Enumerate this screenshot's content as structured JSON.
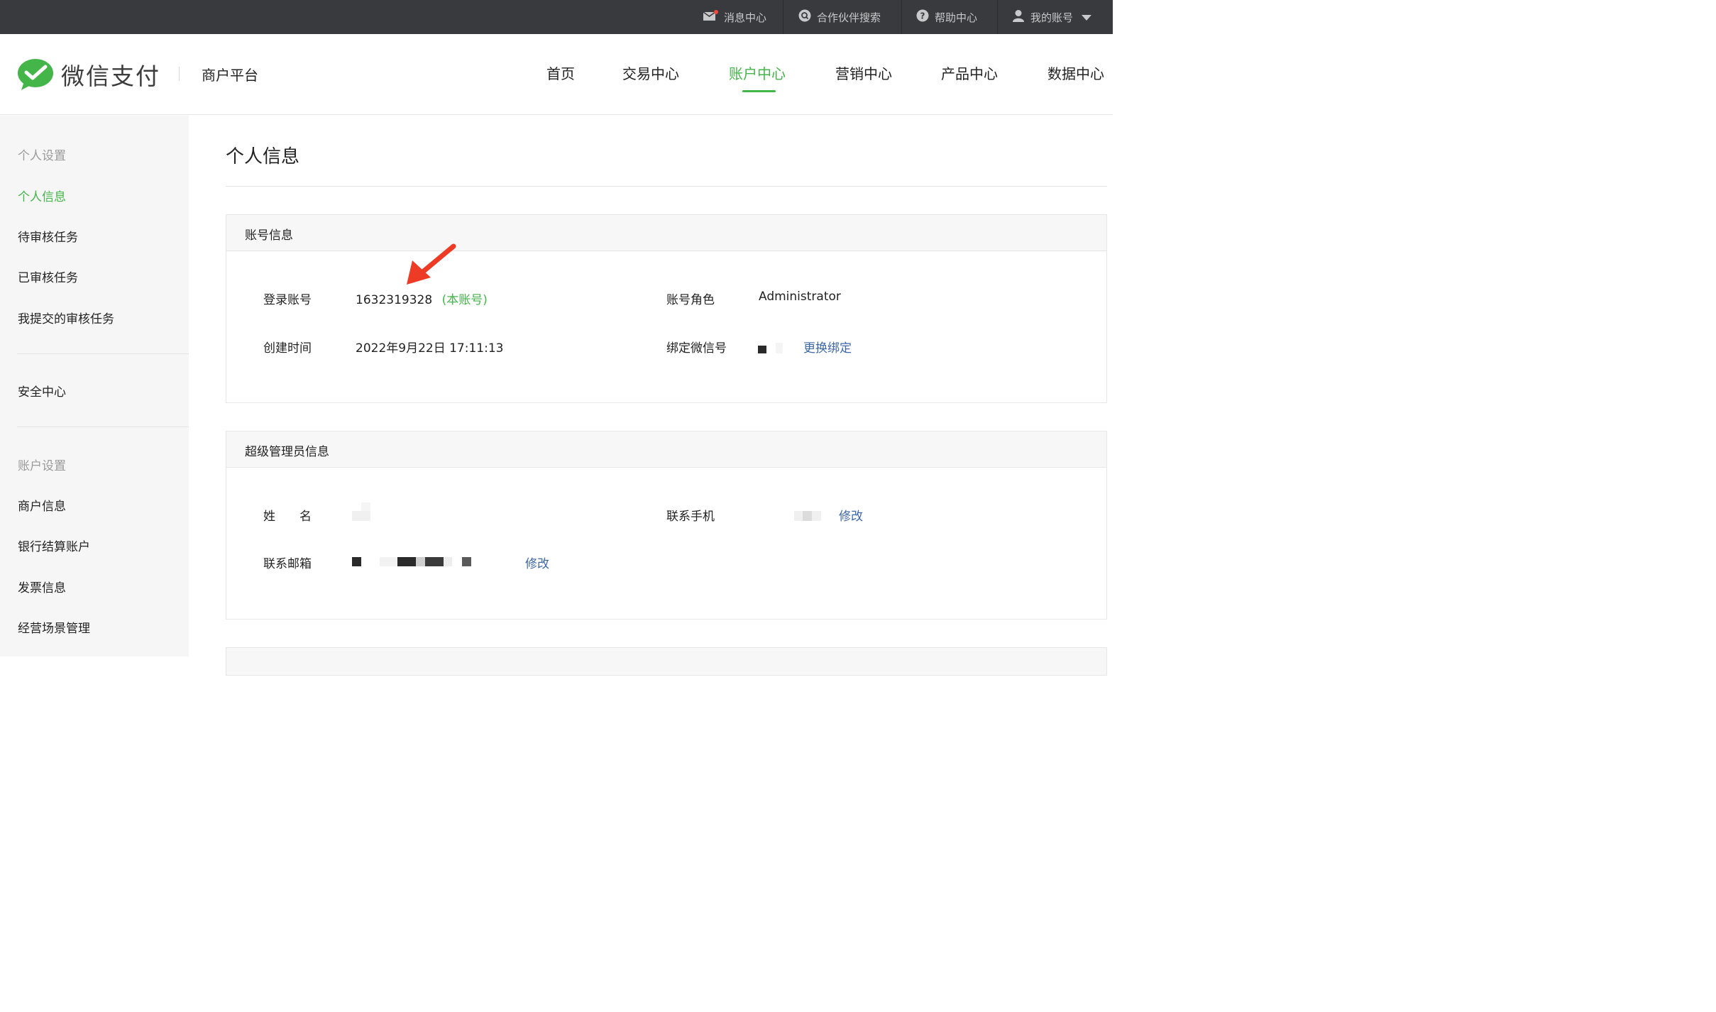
{
  "topbar": {
    "items": [
      "消息中心",
      "合作伙伴搜索",
      "帮助中心",
      "我的账号"
    ]
  },
  "header": {
    "brand": "微信支付",
    "platform": "商户平台",
    "nav": [
      "首页",
      "交易中心",
      "账户中心",
      "营销中心",
      "产品中心",
      "数据中心"
    ],
    "active_nav": "账户中心"
  },
  "sidebar": {
    "group_personal": "个人设置",
    "personal_info": "个人信息",
    "pending_review": "待审核任务",
    "reviewed": "已审核任务",
    "my_submitted": "我提交的审核任务",
    "security_center": "安全中心",
    "group_account": "账户设置",
    "merchant_info": "商户信息",
    "bank_account": "银行结算账户",
    "invoice_info": "发票信息",
    "scene_mgmt": "经营场景管理"
  },
  "main": {
    "title": "个人信息",
    "account_panel": {
      "heading": "账号信息",
      "login_label": "登录账号",
      "login_value": "1632319328",
      "login_tag": "(本账号)",
      "role_label": "账号角色",
      "role_value": "Administrator",
      "created_label": "创建时间",
      "created_value": "2022年9月22日 17:11:13",
      "wechat_label": "绑定微信号",
      "rebind_link": "更换绑定"
    },
    "admin_panel": {
      "heading": "超级管理员信息",
      "name_label": "姓　　名",
      "phone_label": "联系手机",
      "phone_edit": "修改",
      "email_label": "联系邮箱",
      "email_edit": "修改"
    }
  },
  "colors": {
    "accent": "#44b549",
    "link": "#3e67a8",
    "topbar": "#393a3e",
    "arrow": "#ee3b25"
  }
}
